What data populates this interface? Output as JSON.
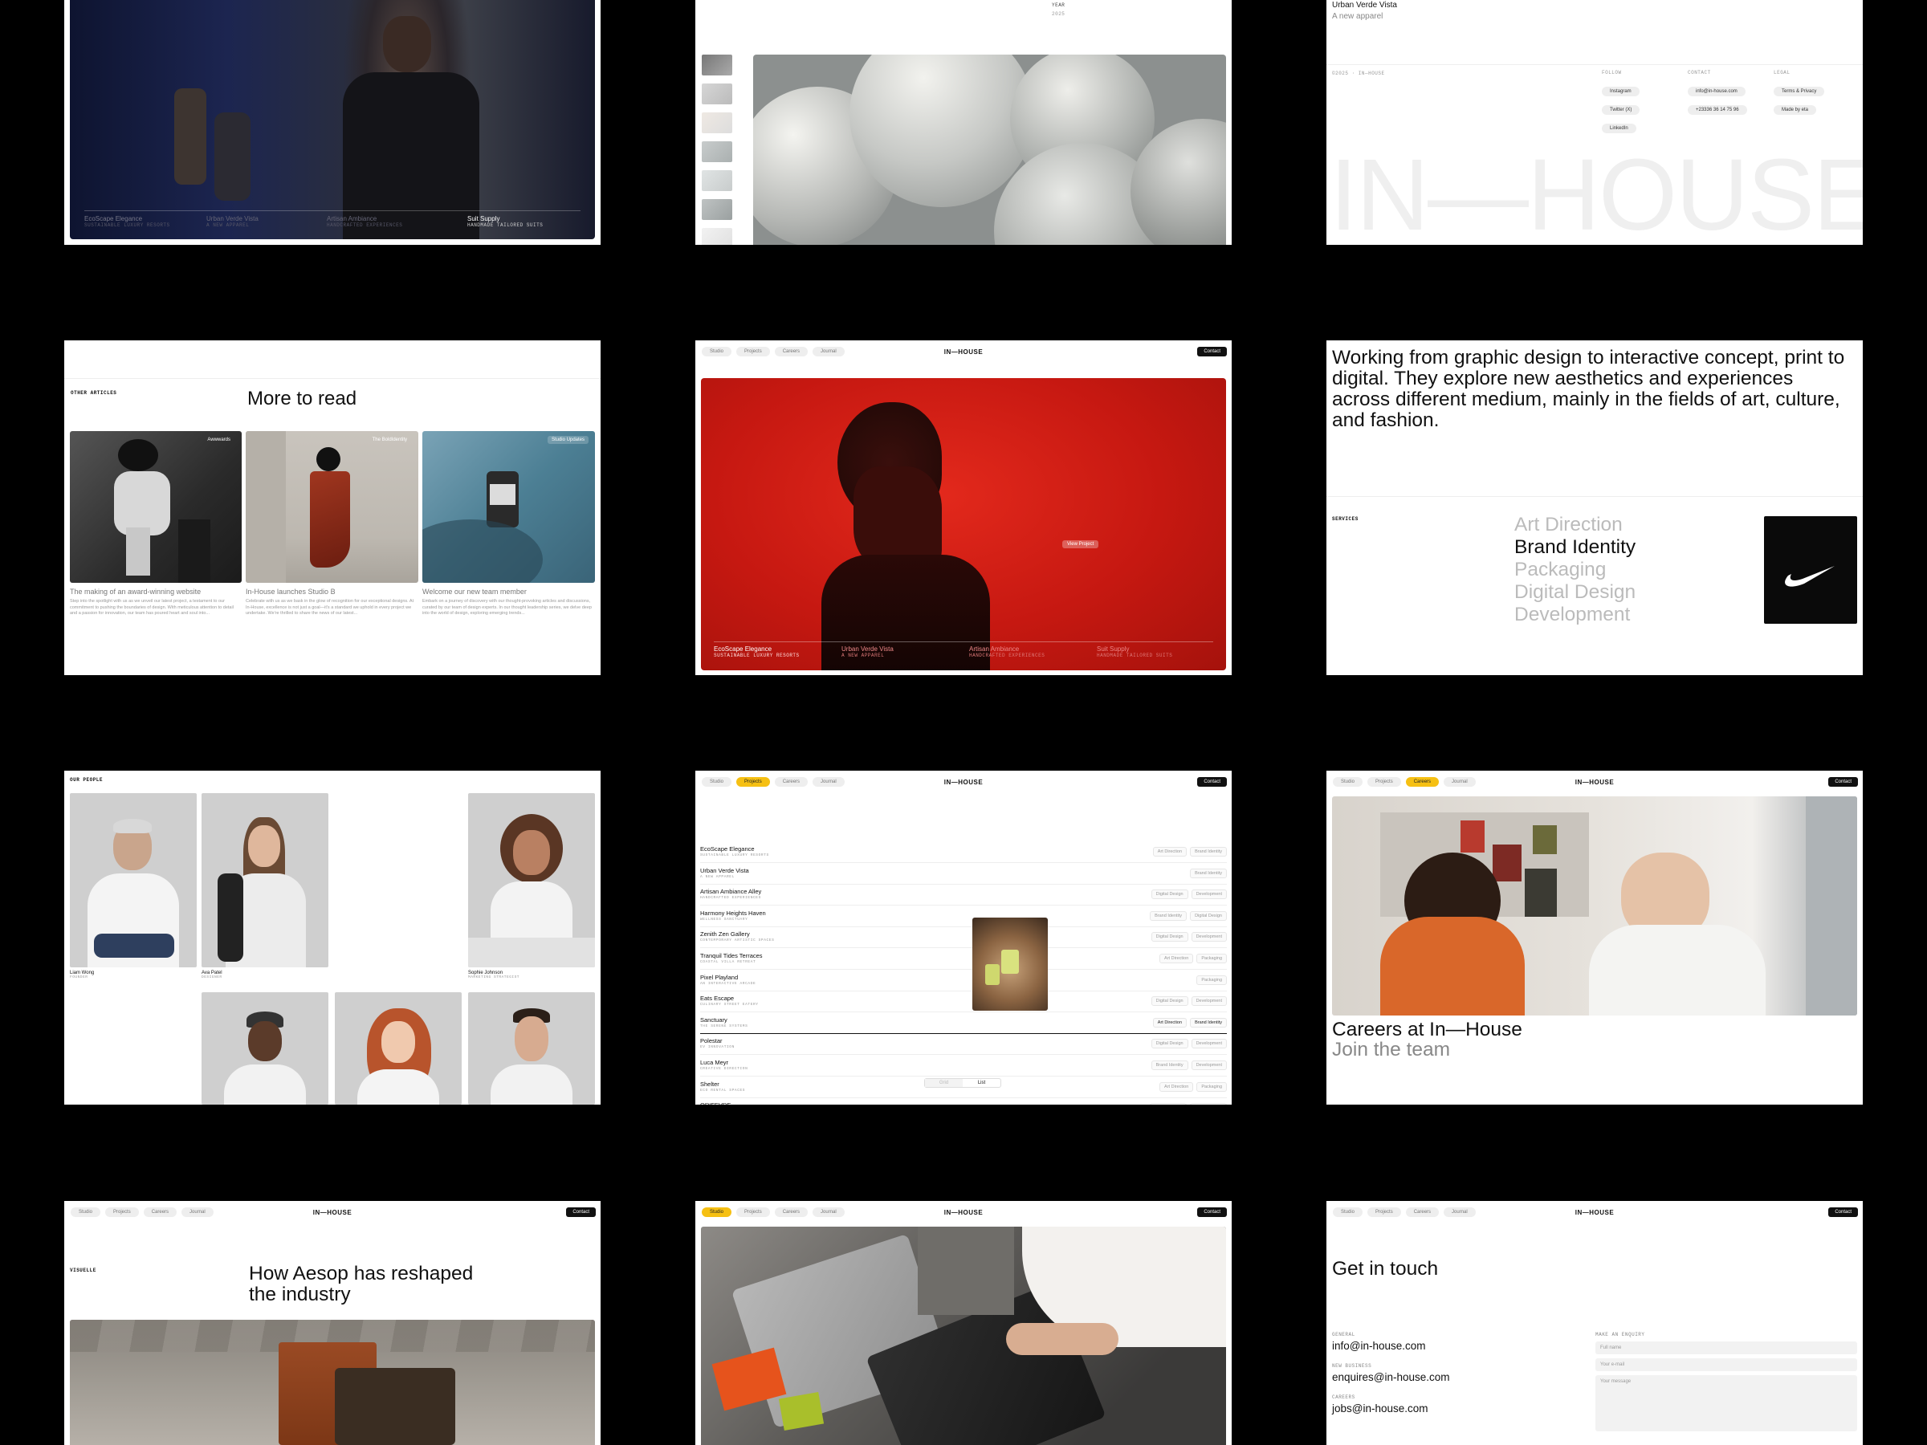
{
  "tile1": {
    "items": [
      {
        "title": "EcoScape Elegance",
        "sub": "SUSTAINABLE LUXURY RESORTS"
      },
      {
        "title": "Urban Verde Vista",
        "sub": "A NEW APPAREL"
      },
      {
        "title": "Artisan Ambiance",
        "sub": "HANDCRAFTED EXPERIENCES"
      },
      {
        "title": "Suit Supply",
        "sub": "HANDMADE TAILORED SUITS"
      }
    ]
  },
  "tile2": {
    "year_label": "YEAR",
    "year_value": "2025"
  },
  "tile3": {
    "project_title": "Urban Verde Vista",
    "project_sub": "A new apparel",
    "copyright": "©2025 · IN—HOUSE",
    "follow_label": "FOLLOW",
    "follow": [
      "Instagram",
      "Twitter (X)",
      "LinkedIn"
    ],
    "contact_label": "CONTACT",
    "contact": [
      "info@in-house.com",
      "+23336 36 14 75 96"
    ],
    "legal_label": "LEGAL",
    "legal": [
      "Terms & Privacy",
      "Made by eta"
    ],
    "big_logo": "IN—HOUSE"
  },
  "tile4": {
    "section_label": "OTHER ARTICLES",
    "heading": "More to read",
    "articles": [
      {
        "badge": "Awwwards",
        "title": "The making of an award-winning website",
        "excerpt": "Step into the spotlight with us as we unveil our latest project, a testament to our commitment to pushing the boundaries of design. With meticulous attention to detail and a passion for innovation, our team has poured heart and soul into..."
      },
      {
        "badge": "The BoldIdentity",
        "title": "In-House launches Studio B",
        "excerpt": "Celebrate with us as we bask in the glow of recognition for our exceptional designs. At In-House, excellence is not just a goal—it's a standard we uphold in every project we undertake. We're thrilled to share the news of our latest..."
      },
      {
        "badge": "Studio Updates",
        "title": "Welcome our new team member",
        "excerpt": "Embark on a journey of discovery with our thought-provoking articles and discussions, curated by our team of design experts. In our thought leadership series, we delve deep into the world of design, exploring emerging trends..."
      }
    ]
  },
  "nav": {
    "items": [
      "Studio",
      "Projects",
      "Careers",
      "Journal"
    ],
    "logo": "IN—HOUSE",
    "contact": "Contact"
  },
  "tile5": {
    "view_button": "View Project",
    "items": [
      {
        "title": "EcoScape Elegance",
        "sub": "SUSTAINABLE LUXURY RESORTS"
      },
      {
        "title": "Urban Verde Vista",
        "sub": "A NEW APPAREL"
      },
      {
        "title": "Artisan Ambiance",
        "sub": "HANDCRAFTED EXPERIENCES"
      },
      {
        "title": "Suit Supply",
        "sub": "HANDMADE TAILORED SUITS"
      }
    ]
  },
  "tile6": {
    "statement": "Working from graphic design to interactive concept, print to digital. They explore new aesthetics and experiences across different medium, mainly in the fields of art, culture, and fashion.",
    "services_label": "SERVICES",
    "services": [
      "Art Direction",
      "Brand Identity",
      "Packaging",
      "Digital Design",
      "Development"
    ]
  },
  "tile7": {
    "section_label": "OUR PEOPLE",
    "people": [
      {
        "name": "Liam Wong",
        "role": "FOUNDER"
      },
      {
        "name": "Ava Patel",
        "role": "DESIGNER"
      },
      {
        "name": "Sophie Johnson",
        "role": "MARKETING STRATEGIST"
      }
    ]
  },
  "tile8": {
    "projects": [
      {
        "name": "EcoScape Elegance",
        "sub": "SUSTAINABLE LUXURY RESORTS",
        "tags": [
          "Art Direction",
          "Brand Identity"
        ]
      },
      {
        "name": "Urban Verde Vista",
        "sub": "A NEW APPAREL",
        "tags": [
          "Brand Identity"
        ]
      },
      {
        "name": "Artisan Ambiance Alley",
        "sub": "HANDCRAFTED EXPERIENCES",
        "tags": [
          "Digital Design",
          "Development"
        ]
      },
      {
        "name": "Harmony Heights Haven",
        "sub": "WELLNESS SANCTUARY",
        "tags": [
          "Brand Identity",
          "Digital Design"
        ]
      },
      {
        "name": "Zenith Zen Gallery",
        "sub": "CONTEMPORARY ARTISTIC SPACES",
        "tags": [
          "Digital Design",
          "Development"
        ]
      },
      {
        "name": "Tranquil Tides Terraces",
        "sub": "COASTAL VILLA RETREAT",
        "tags": [
          "Art Direction",
          "Packaging"
        ]
      },
      {
        "name": "Pixel Playland",
        "sub": "AN INTERACTIVE ARCADE",
        "tags": [
          "Packaging"
        ]
      },
      {
        "name": "Eats Escape",
        "sub": "CULINARY STREET EATERY",
        "tags": [
          "Digital Design",
          "Development"
        ]
      },
      {
        "name": "Sanctuary",
        "sub": "THE SERENE SYSTEMS",
        "tags": [
          "Art Direction",
          "Brand Identity"
        ]
      },
      {
        "name": "Polestar",
        "sub": "EV INNOVATION",
        "tags": [
          "Digital Design",
          "Development"
        ]
      },
      {
        "name": "Luca Meyr",
        "sub": "CREATIVE DIRECTION",
        "tags": [
          "Brand Identity",
          "Development"
        ]
      },
      {
        "name": "Shelter",
        "sub": "ECO RENTAL SPACES",
        "tags": [
          "Art Direction",
          "Packaging"
        ]
      },
      {
        "name": "ORIFEVRE",
        "sub": "",
        "tags": [
          "Digital Design",
          "Brand Identity"
        ]
      }
    ],
    "view_toggle": [
      "Grid",
      "List"
    ]
  },
  "tile9": {
    "heading": "Careers at In—House",
    "sub": "Join the team"
  },
  "tile10": {
    "label": "VISUELLE",
    "heading_line1": "How Aesop has reshaped",
    "heading_line2": "the industry"
  },
  "tile12": {
    "heading": "Get in touch",
    "general_label": "GENERAL",
    "general": "info@in-house.com",
    "business_label": "NEW BUSINESS",
    "business": "enquires@in-house.com",
    "careers_label": "CAREERS",
    "careers": "jobs@in-house.com",
    "enquiry_label": "MAKE AN ENQUIRY",
    "fields": [
      "Full name",
      "Your e-mail",
      "Your message"
    ]
  },
  "colors": {
    "accent": "#f6c013",
    "red": "#d3170f",
    "black": "#000000"
  }
}
